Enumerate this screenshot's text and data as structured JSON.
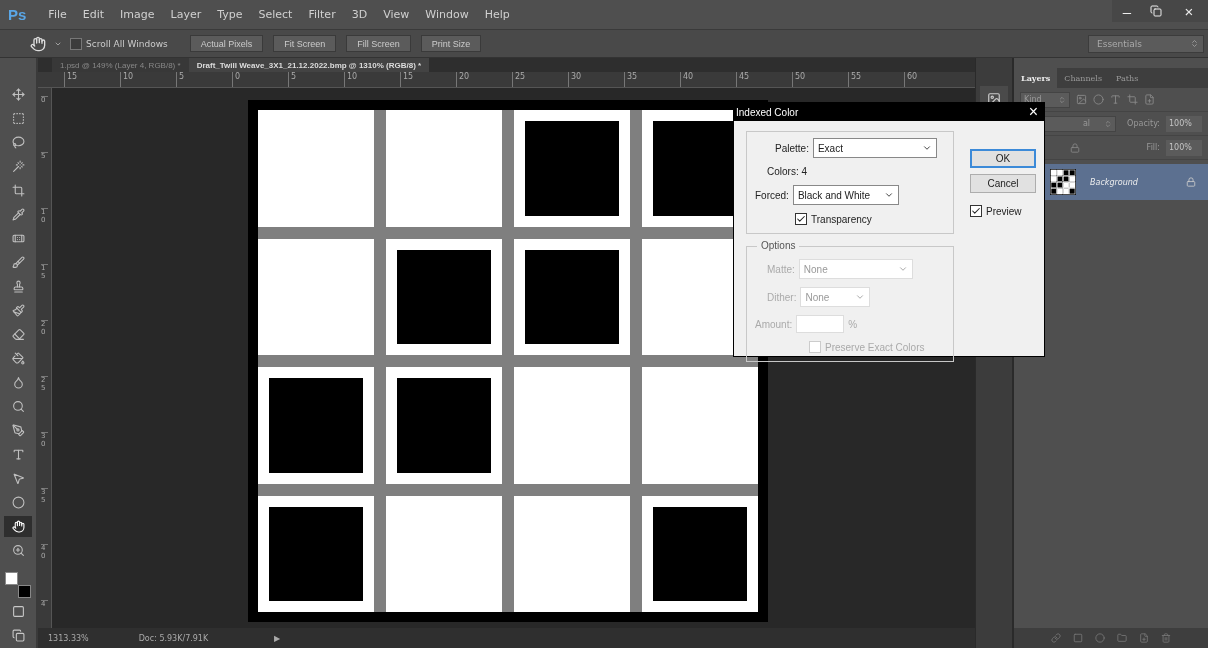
{
  "app": {
    "logo": "Ps"
  },
  "menu": [
    "File",
    "Edit",
    "Image",
    "Layer",
    "Type",
    "Select",
    "Filter",
    "3D",
    "View",
    "Window",
    "Help"
  ],
  "window_controls": {
    "minimize": "–",
    "close": "×"
  },
  "options_bar": {
    "scroll_all_windows": {
      "label": "Scroll All Windows",
      "checked": false
    },
    "buttons": [
      "Actual Pixels",
      "Fit Screen",
      "Fill Screen",
      "Print Size"
    ],
    "workspace": "Essentials"
  },
  "document_tabs": [
    {
      "label": "1.psd @ 149% (Layer 4, RGB/8) *",
      "selected": false
    },
    {
      "label": "Draft_Twill Weave_3X1_21.12.2022.bmp @ 1310% (RGB/8) *",
      "selected": true
    }
  ],
  "horizontal_ruler": [
    "15",
    "10",
    "5",
    "0",
    "5",
    "10",
    "15",
    "20",
    "25",
    "30",
    "35",
    "40",
    "45",
    "50",
    "55",
    "60"
  ],
  "vertical_ruler": [
    "0",
    "5",
    "10",
    "15",
    "20",
    "25",
    "30",
    "35",
    "40",
    "4"
  ],
  "tools": [
    {
      "kind": "move",
      "selected": false
    },
    {
      "kind": "marquee",
      "selected": false
    },
    {
      "kind": "lasso",
      "selected": false
    },
    {
      "kind": "wand",
      "selected": false
    },
    {
      "kind": "crop",
      "selected": false
    },
    {
      "kind": "eyedropper",
      "selected": false
    },
    {
      "kind": "healing",
      "selected": false
    },
    {
      "kind": "brush",
      "selected": false
    },
    {
      "kind": "stamp",
      "selected": false
    },
    {
      "kind": "history",
      "selected": false
    },
    {
      "kind": "eraser",
      "selected": false
    },
    {
      "kind": "bucket",
      "selected": false
    },
    {
      "kind": "blur",
      "selected": false
    },
    {
      "kind": "dodge",
      "selected": false
    },
    {
      "kind": "pen",
      "selected": false
    },
    {
      "kind": "type",
      "selected": false
    },
    {
      "kind": "path",
      "selected": false
    },
    {
      "kind": "shape",
      "selected": false
    },
    {
      "kind": "hand",
      "selected": true
    },
    {
      "kind": "zoom",
      "selected": false
    }
  ],
  "document": {
    "grid": [
      [
        {
          "filled": false
        },
        {
          "filled": false
        },
        {
          "filled": true
        },
        {
          "filled": true
        }
      ],
      [
        {
          "filled": false
        },
        {
          "filled": true
        },
        {
          "filled": true
        },
        {
          "filled": false
        }
      ],
      [
        {
          "filled": true
        },
        {
          "filled": true
        },
        {
          "filled": false
        },
        {
          "filled": false
        }
      ],
      [
        {
          "filled": true
        },
        {
          "filled": false
        },
        {
          "filled": false
        },
        {
          "filled": true
        }
      ]
    ]
  },
  "status_bar": {
    "zoom": "1313.33%",
    "doc": "Doc: 5.93K/7.91K",
    "arrow": "▶"
  },
  "layers_panel": {
    "tabs": [
      {
        "label": "Layers",
        "selected": true
      },
      {
        "label": "Channels",
        "selected": false
      },
      {
        "label": "Paths",
        "selected": false
      }
    ],
    "filter": "Kind",
    "blend_mode": "al",
    "opacity_label": "Opacity:",
    "opacity": "100%",
    "fill_label": "Fill:",
    "fill": "100%",
    "layers": [
      {
        "name": "Background",
        "selected": true
      }
    ]
  },
  "dialog": {
    "title": "Indexed Color",
    "close": "×",
    "palette_label": "Palette:",
    "palette": "Exact",
    "colors": "Colors: 4",
    "forced_label": "Forced:",
    "forced": "Black and White",
    "transparency": {
      "label": "Transparency",
      "checked": true
    },
    "options_label": "Options",
    "matte_label": "Matte:",
    "matte": "None",
    "dither_label": "Dither:",
    "dither": "None",
    "amount_label": "Amount:",
    "percent": "%",
    "preserve": {
      "label": "Preserve Exact Colors",
      "checked": false,
      "disabled": true
    },
    "options_disabled": true,
    "ok": "OK",
    "cancel": "Cancel",
    "preview": {
      "label": "Preview",
      "checked": true
    }
  }
}
